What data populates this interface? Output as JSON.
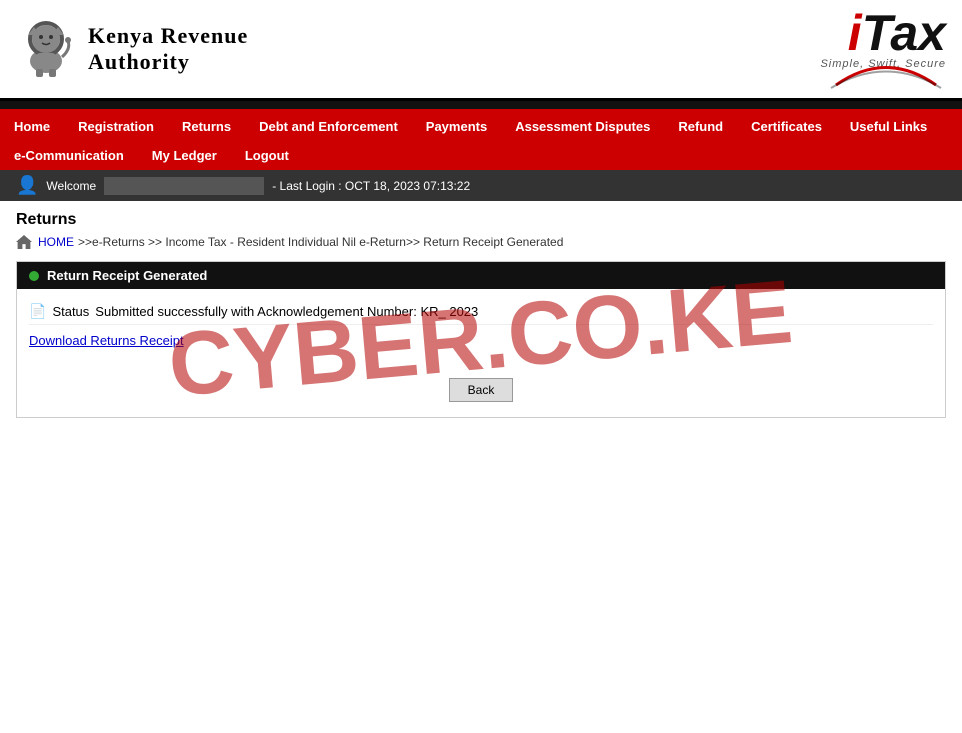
{
  "header": {
    "kra_line1": "Kenya Revenue",
    "kra_line2": "Authority",
    "itax_i": "i",
    "itax_tax": "Tax",
    "itax_tagline": "Simple, Swift, Secure"
  },
  "nav": {
    "row1": [
      {
        "label": "Home",
        "id": "home"
      },
      {
        "label": "Registration",
        "id": "registration"
      },
      {
        "label": "Returns",
        "id": "returns"
      },
      {
        "label": "Debt and Enforcement",
        "id": "debt"
      },
      {
        "label": "Payments",
        "id": "payments"
      },
      {
        "label": "Assessment Disputes",
        "id": "assessment"
      },
      {
        "label": "Refund",
        "id": "refund"
      },
      {
        "label": "Certificates",
        "id": "certificates"
      },
      {
        "label": "Useful Links",
        "id": "useful-links"
      }
    ],
    "row2": [
      {
        "label": "e-Communication",
        "id": "e-comm"
      },
      {
        "label": "My Ledger",
        "id": "ledger"
      },
      {
        "label": "Logout",
        "id": "logout"
      }
    ]
  },
  "welcome": {
    "prefix": "Welcome",
    "suffix": "- Last Login : OCT 18, 2023 07:13:22"
  },
  "breadcrumb": {
    "home": "HOME",
    "path": ">>e-Returns >> Income Tax - Resident Individual Nil e-Return>> Return Receipt Generated"
  },
  "page": {
    "title": "Returns",
    "box_header": "Return Receipt Generated",
    "success_label": "Status",
    "success_message": "Submitted successfully with Acknowledgement Number: KR_ 2023",
    "download_label": "Download Returns Receipt",
    "back_button": "Back"
  },
  "watermark": {
    "text": "CYBER.CO.KE"
  }
}
